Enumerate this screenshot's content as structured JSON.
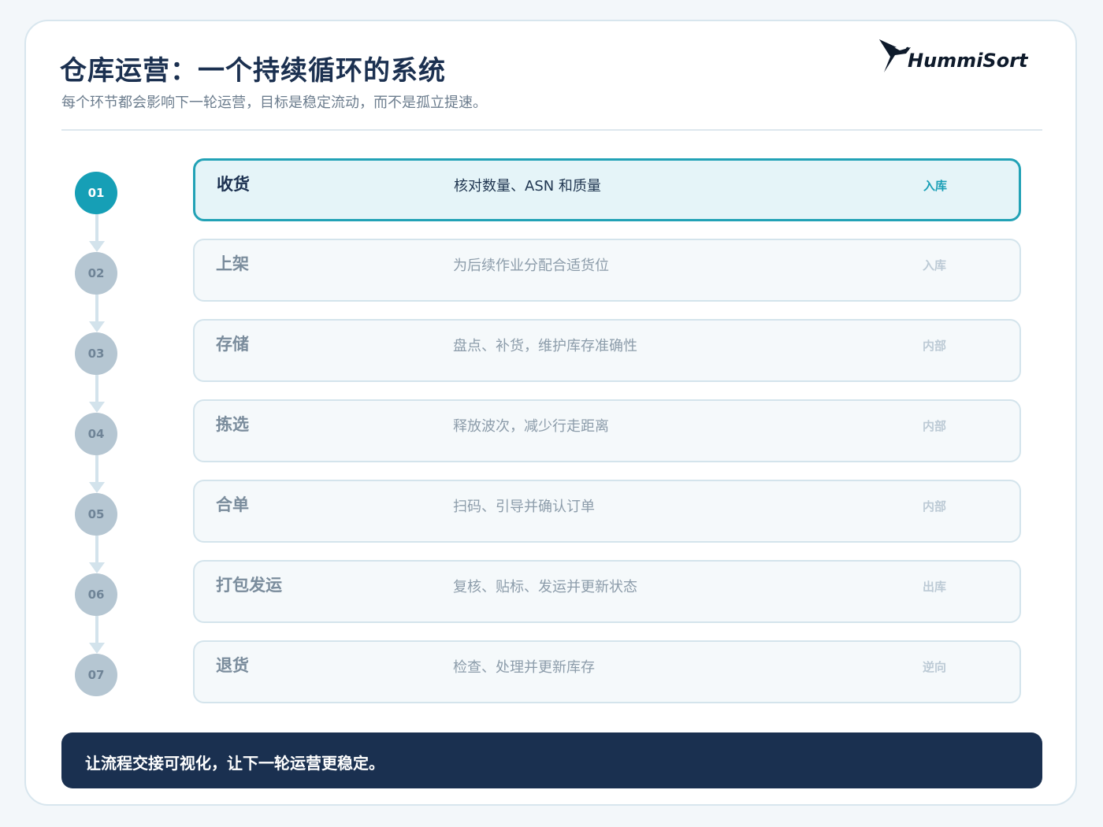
{
  "header": {
    "title": "仓库运营：一个持续循环的系统",
    "subtitle": "每个环节都会影响下一轮运营，目标是稳定流动，而不是孤立提速。",
    "logo_text": "HummiSort"
  },
  "steps": [
    {
      "number": "01",
      "name": "收货",
      "description": "核对数量、ASN 和质量",
      "tag": "入库",
      "active": true
    },
    {
      "number": "02",
      "name": "上架",
      "description": "为后续作业分配合适货位",
      "tag": "入库",
      "active": false
    },
    {
      "number": "03",
      "name": "存储",
      "description": "盘点、补货，维护库存准确性",
      "tag": "内部",
      "active": false
    },
    {
      "number": "04",
      "name": "拣选",
      "description": "释放波次，减少行走距离",
      "tag": "内部",
      "active": false
    },
    {
      "number": "05",
      "name": "合单",
      "description": "扫码、引导并确认订单",
      "tag": "内部",
      "active": false
    },
    {
      "number": "06",
      "name": "打包发运",
      "description": "复核、贴标、发运并更新状态",
      "tag": "出库",
      "active": false
    },
    {
      "number": "07",
      "name": "退货",
      "description": "检查、处理并更新库存",
      "tag": "逆向",
      "active": false
    }
  ],
  "footer": {
    "text": "让流程交接可视化，让下一轮运营更稳定。"
  },
  "colors": {
    "accent": "#169fb6",
    "navy": "#1a3050",
    "inactive_node": "#b5c6d2"
  }
}
